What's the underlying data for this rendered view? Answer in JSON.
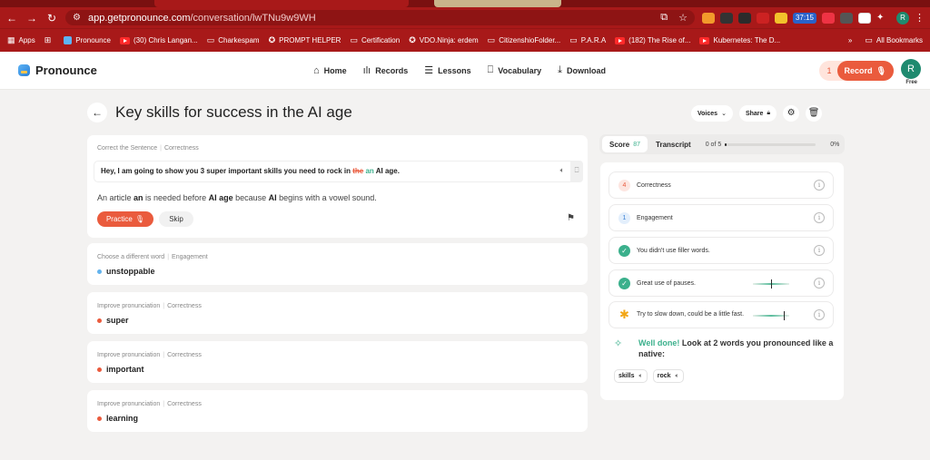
{
  "browser": {
    "url_host": "app.getpronounce.com",
    "url_path": "/conversation/lwTNu9w9WH",
    "ext_badge": "37:15",
    "profile_initial": "R",
    "bookmarks": [
      {
        "label": "Apps",
        "icon": "apps-grid-icon"
      },
      {
        "label": "Pronounce",
        "icon": "pronounce-favicon"
      },
      {
        "label": "(30) Chris Langan...",
        "icon": "youtube-icon"
      },
      {
        "label": "Charkespam",
        "icon": "folder-icon"
      },
      {
        "label": "PROMPT HELPER",
        "icon": "openai-icon"
      },
      {
        "label": "Certification",
        "icon": "folder-icon"
      },
      {
        "label": "VDO.Ninja: erdem",
        "icon": "ninja-icon"
      },
      {
        "label": "CitizenshioFolder...",
        "icon": "folder-icon"
      },
      {
        "label": "P.A.R.A",
        "icon": "folder-icon"
      },
      {
        "label": "(182) The Rise of...",
        "icon": "youtube-icon"
      },
      {
        "label": "Kubernetes: The D...",
        "icon": "kubernetes-icon"
      }
    ],
    "all_bookmarks": "All Bookmarks"
  },
  "app": {
    "logo": "Pronounce",
    "nav": [
      {
        "label": "Home",
        "icon": "home-icon"
      },
      {
        "label": "Records",
        "icon": "waveform-icon"
      },
      {
        "label": "Lessons",
        "icon": "lessons-icon"
      },
      {
        "label": "Vocabulary",
        "icon": "bookmark-icon"
      },
      {
        "label": "Download",
        "icon": "download-icon"
      }
    ],
    "record_count": "1",
    "record_label": "Record",
    "avatar_initial": "R",
    "plan": "Free"
  },
  "page": {
    "title": "Key skills for success in the AI age",
    "voices": "Voices",
    "share": "Share"
  },
  "main_card": {
    "type": "Correct the Sentence",
    "category": "Correctness",
    "sentence_before": "Hey, I am going to show you 3 super important skills you need to rock in ",
    "struck": "the",
    "inserted": "an",
    "sentence_after": "AI age.",
    "explain": {
      "p1": "An article ",
      "w1": "an",
      "p2": " is needed before ",
      "w2": "AI age",
      "p3": " because ",
      "w3": "AI",
      "p4": " begins with a vowel sound."
    },
    "practice": "Practice",
    "skip": "Skip"
  },
  "suggestions": [
    {
      "type": "Choose a different word",
      "category": "Engagement",
      "word": "unstoppable",
      "dot": "#63b3ed"
    },
    {
      "type": "Improve pronunciation",
      "category": "Correctness",
      "word": "super",
      "dot": "#ea5b3d"
    },
    {
      "type": "Improve pronunciation",
      "category": "Correctness",
      "word": "important",
      "dot": "#ea5b3d"
    },
    {
      "type": "Improve pronunciation",
      "category": "Correctness",
      "word": "learning",
      "dot": "#ea5b3d"
    }
  ],
  "panel": {
    "score_label": "Score",
    "score_value": "87",
    "transcript_label": "Transcript",
    "progress_text": "0 of 5",
    "progress_fraction": 0.02,
    "progress_pct": "0%",
    "metrics": [
      {
        "count": "4",
        "label": "Correctness"
      },
      {
        "count": "1",
        "label": "Engagement"
      },
      {
        "label": "You didn't use filler words."
      },
      {
        "label": "Great use of pauses.",
        "gauge_level": 0.5
      },
      {
        "label": "Try to slow down, could be a little fast.",
        "gauge_level": 0.85
      }
    ],
    "well_done": "Well done!",
    "well_done_rest": " Look at 2 words you pronounced like a native:",
    "native_words": [
      "skills",
      "rock"
    ]
  },
  "colors": {
    "accent": "#ea5b3d",
    "success": "#3bb08c",
    "browser_chrome": "#a81919"
  }
}
